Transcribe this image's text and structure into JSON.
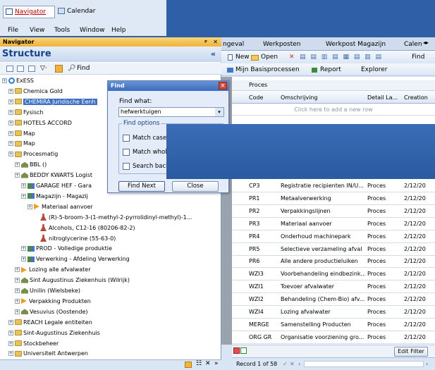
{
  "topbar": {
    "tabs": [
      "Navigator",
      "Calendar"
    ]
  },
  "menubar": {
    "items": [
      "File",
      "View",
      "Tools",
      "Window",
      "Help"
    ]
  },
  "navigator": {
    "title": "Navigator",
    "pin": "ᵖ",
    "close": "✕",
    "structure_title": "Structure",
    "find_label": "Find",
    "tree": [
      {
        "label": "ExESS",
        "indent": 0,
        "kind": "root"
      },
      {
        "label": "Chemica Gold",
        "indent": 1,
        "kind": "folder"
      },
      {
        "label": "CHEMIRA Juridische Eenh",
        "indent": 1,
        "kind": "folder-selected"
      },
      {
        "label": "Fysisch",
        "indent": 1,
        "kind": "folder"
      },
      {
        "label": "HOTELS ACCORD",
        "indent": 1,
        "kind": "folder"
      },
      {
        "label": "Map",
        "indent": 1,
        "kind": "folder"
      },
      {
        "label": "Map",
        "indent": 1,
        "kind": "folder"
      },
      {
        "label": "Procesmatig",
        "indent": 1,
        "kind": "folder"
      },
      {
        "label": "BBL ()",
        "indent": 2,
        "kind": "house"
      },
      {
        "label": "BEDDY KWARTS Logist",
        "indent": 2,
        "kind": "house"
      },
      {
        "label": "GARAGE HEF - Gara",
        "indent": 3,
        "kind": "process"
      },
      {
        "label": "Magazijn - Magazij",
        "indent": 3,
        "kind": "process"
      },
      {
        "label": "Materiaal aanvoer",
        "indent": 4,
        "kind": "arrow"
      },
      {
        "label": "(R)-5-broom-3-(1-methyl-2-pyrrolidinyl-methyl)-1...",
        "indent": 5,
        "kind": "flask"
      },
      {
        "label": "Alcohols, C12-16 (80206-82-2)",
        "indent": 5,
        "kind": "flask"
      },
      {
        "label": "nitroglycerine (55-63-0)",
        "indent": 5,
        "kind": "flask"
      },
      {
        "label": "PROD - Volledige produktie",
        "indent": 3,
        "kind": "process"
      },
      {
        "label": "Verwerking - Afdeling Verwerking",
        "indent": 3,
        "kind": "process"
      },
      {
        "label": "Lozing alle afvalwater",
        "indent": 2,
        "kind": "arrow"
      },
      {
        "label": "Sint Augustinus Ziekenhuis (Wilrijk)",
        "indent": 2,
        "kind": "house"
      },
      {
        "label": "Unilin (Wielsbeke)",
        "indent": 2,
        "kind": "house"
      },
      {
        "label": "Verpakking Produkten",
        "indent": 2,
        "kind": "arrow"
      },
      {
        "label": "Vesuvius (Oostende)",
        "indent": 2,
        "kind": "house"
      },
      {
        "label": "REACH Legale entiteiten",
        "indent": 1,
        "kind": "folder"
      },
      {
        "label": "Sint-Augustinus Ziekenhuis",
        "indent": 1,
        "kind": "folder"
      },
      {
        "label": "Stockbeheer",
        "indent": 1,
        "kind": "folder"
      },
      {
        "label": "Universiteit Antwerpen",
        "indent": 1,
        "kind": "folder"
      }
    ]
  },
  "find_dialog": {
    "title": "Find",
    "what_label": "Find what:",
    "what_value": "hefwerktuigen",
    "options_label": "Find options",
    "match_case": "Match case",
    "match_whole": "Match whole",
    "search_back": "Search back",
    "find_next": "Find Next",
    "close": "Close"
  },
  "doc_tabs": [
    "ngeval",
    "Werkposten",
    "Werkpost Magazijn",
    "Calen"
  ],
  "toolbar": {
    "new": "New",
    "open": "Open",
    "find": "Find"
  },
  "toolbar2": {
    "mijn": "Mijn Basisprocessen",
    "report": "Report",
    "explorer": "Explorer"
  },
  "grid": {
    "group": "Proces",
    "columns": [
      "Code",
      "Omschrijving",
      "Detail La...",
      "Creation"
    ],
    "add_row": "Click here to add a new row",
    "rows": [
      [
        "CP3",
        "Registratie recipienten IN/U...",
        "Proces",
        "2/12/20"
      ],
      [
        "PR1",
        "Metaalverwerking",
        "Proces",
        "2/12/20"
      ],
      [
        "PR2",
        "Verpakkingslijnen",
        "Proces",
        "2/12/20"
      ],
      [
        "PR3",
        "Materiaal aanvoer",
        "Proces",
        "2/12/20"
      ],
      [
        "PR4",
        "Onderhoud machinepark",
        "Proces",
        "2/12/20"
      ],
      [
        "PR5",
        "Selectieve verzameling afval",
        "Proces",
        "2/12/20"
      ],
      [
        "PR6",
        "Alle andere productieluiken",
        "Proces",
        "2/12/20"
      ],
      [
        "WZI3",
        "Voorbehandeling eindbezink...",
        "Proces",
        "2/12/20"
      ],
      [
        "WZI1",
        "Toevoer afvalwater",
        "Proces",
        "2/12/20"
      ],
      [
        "WZI2",
        "Behandeling (Chem-Bio) afv...",
        "Proces",
        "2/12/20"
      ],
      [
        "WZI4",
        "Lozing afvalwater",
        "Proces",
        "2/12/20"
      ],
      [
        "MERGE",
        "Samenstelling Producten",
        "Proces",
        "2/12/20"
      ],
      [
        "ORG GR",
        "Organisatie voorziening gro...",
        "Proces",
        "2/12/20"
      ]
    ],
    "edit_filter": "Edit Filter",
    "record_label": "Record 1 of 58"
  }
}
